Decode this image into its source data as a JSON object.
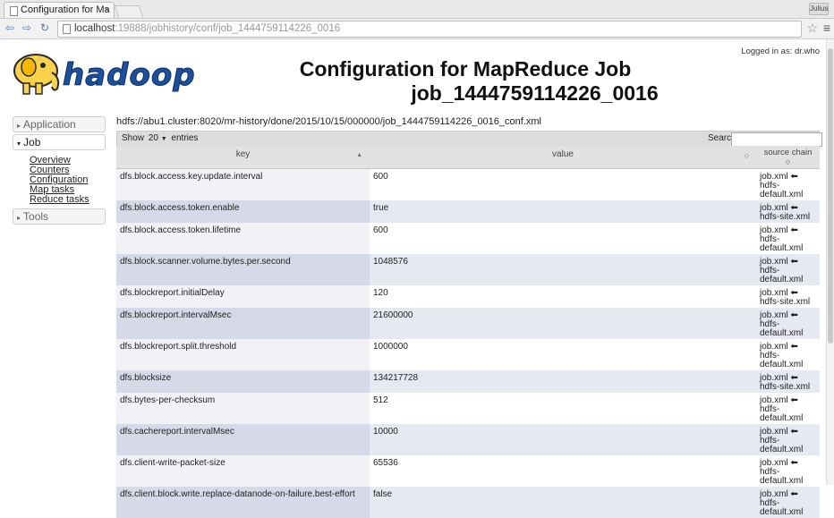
{
  "browser": {
    "tab_title": "Configuration for Ma",
    "tab_close": "×",
    "user_badge": "Julius",
    "url_host": "localhost",
    "url_path": ":19888/jobhistory/conf/job_1444759114226_0016",
    "menu_icon": "≡",
    "star_icon": "☆"
  },
  "header": {
    "logo_text": "hadoop",
    "title_line1": "Configuration for MapReduce Job",
    "title_line2": "job_1444759114226_0016",
    "logged_in": "Logged in as: dr.who"
  },
  "sidebar": {
    "application_label": "Application",
    "job_label": "Job",
    "job_links": [
      "Overview",
      "Counters",
      "Configuration",
      "Map tasks",
      "Reduce tasks"
    ],
    "tools_label": "Tools"
  },
  "main": {
    "conf_path": "hdfs://abu1.cluster:8020/mr-history/done/2015/10/15/000000/job_1444759114226_0016_conf.xml",
    "show_label": "Show",
    "entries_value": "20",
    "entries_label": "entries",
    "search_label": "Search:",
    "columns": {
      "key": "key",
      "value": "value",
      "source": "source chain"
    },
    "rows": [
      {
        "key": "dfs.block.access.key.update.interval",
        "value": "600",
        "source": [
          "job.xml ⬅",
          "hdfs-",
          "default.xml"
        ]
      },
      {
        "key": "dfs.block.access.token.enable",
        "value": "true",
        "source": [
          "job.xml ⬅",
          "hdfs-site.xml"
        ]
      },
      {
        "key": "dfs.block.access.token.lifetime",
        "value": "600",
        "source": [
          "job.xml ⬅",
          "hdfs-",
          "default.xml"
        ]
      },
      {
        "key": "dfs.block.scanner.volume.bytes.per.second",
        "value": "1048576",
        "source": [
          "job.xml ⬅",
          "hdfs-",
          "default.xml"
        ]
      },
      {
        "key": "dfs.blockreport.initialDelay",
        "value": "120",
        "source": [
          "job.xml ⬅",
          "hdfs-site.xml"
        ]
      },
      {
        "key": "dfs.blockreport.intervalMsec",
        "value": "21600000",
        "source": [
          "job.xml ⬅",
          "hdfs-",
          "default.xml"
        ]
      },
      {
        "key": "dfs.blockreport.split.threshold",
        "value": "1000000",
        "source": [
          "job.xml ⬅",
          "hdfs-",
          "default.xml"
        ]
      },
      {
        "key": "dfs.blocksize",
        "value": "134217728",
        "source": [
          "job.xml ⬅",
          "hdfs-site.xml"
        ]
      },
      {
        "key": "dfs.bytes-per-checksum",
        "value": "512",
        "source": [
          "job.xml ⬅",
          "hdfs-",
          "default.xml"
        ]
      },
      {
        "key": "dfs.cachereport.intervalMsec",
        "value": "10000",
        "source": [
          "job.xml ⬅",
          "hdfs-",
          "default.xml"
        ]
      },
      {
        "key": "dfs.client-write-packet-size",
        "value": "65536",
        "source": [
          "job.xml ⬅",
          "hdfs-",
          "default.xml"
        ]
      },
      {
        "key": "dfs.client.block.write.replace-datanode-on-failure.best-effort",
        "value": "false",
        "source": [
          "job.xml ⬅",
          "hdfs-",
          "default.xml"
        ]
      }
    ]
  }
}
